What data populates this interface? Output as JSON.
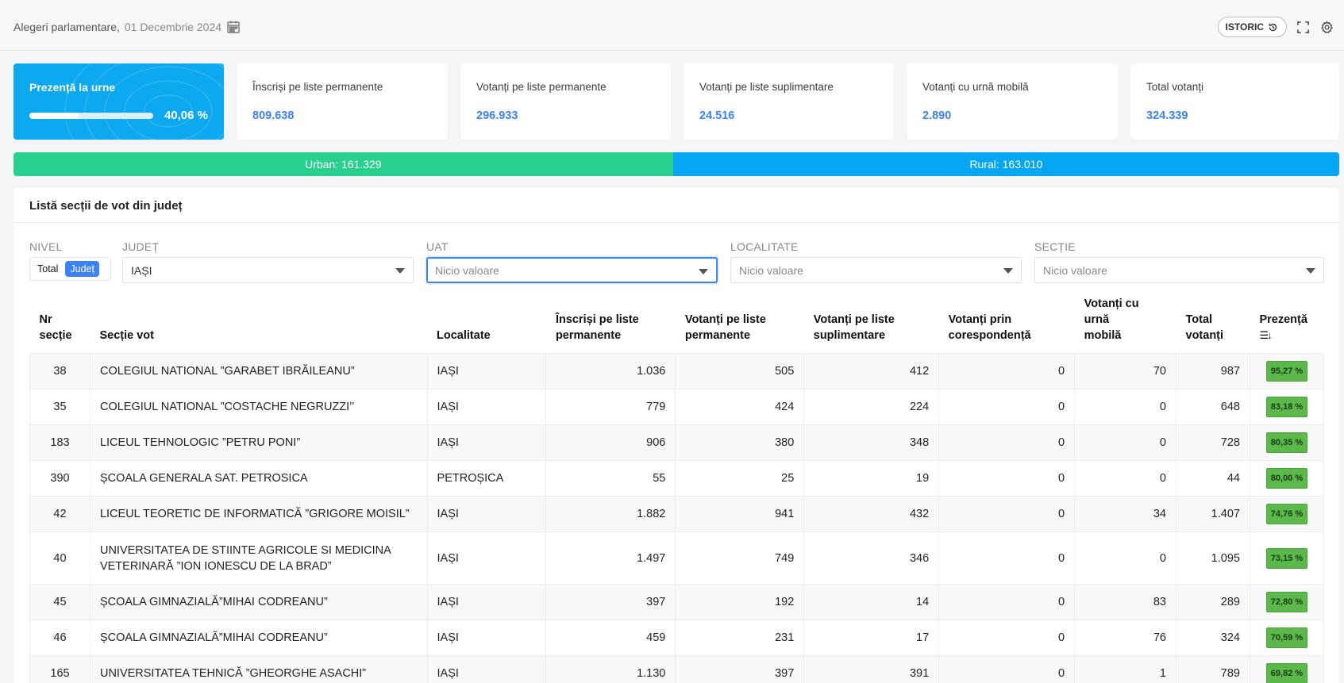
{
  "header": {
    "title": "Alegeri parlamentare,",
    "date": "01 Decembrie 2024",
    "istoric_label": "ISTORIC"
  },
  "cards": [
    {
      "label": "Prezență la urne",
      "value": "40,06 %",
      "progress": 0.4006
    },
    {
      "label": "Înscriși pe liste permanente",
      "value": "809.638"
    },
    {
      "label": "Votanți pe liste permanente",
      "value": "296.933"
    },
    {
      "label": "Votanți pe liste suplimentare",
      "value": "24.516"
    },
    {
      "label": "Votanți cu urnă mobilă",
      "value": "2.890"
    },
    {
      "label": "Total votanți",
      "value": "324.339"
    }
  ],
  "split": {
    "urban_label": "Urban: 161.329",
    "rural_label": "Rural: 163.010",
    "urban_value": 161329,
    "rural_value": 163010
  },
  "panel": {
    "title": "Listă secții de vot din județ"
  },
  "filters": {
    "nivel_label": "NIVEL",
    "nivel_options": [
      "Total",
      "Județ"
    ],
    "judet_label": "JUDEȚ",
    "judet_value": "IAȘI",
    "uat_label": "UAT",
    "uat_placeholder": "Nicio valoare",
    "localitate_label": "LOCALITATE",
    "localitate_placeholder": "Nicio valoare",
    "sectie_label": "SECȚIE",
    "sectie_placeholder": "Nicio valoare"
  },
  "table": {
    "headers": {
      "nr_line1": "Nr",
      "nr_line2": "secție",
      "sectie": "Secție vot",
      "localitate": "Localitate",
      "inscrisi_line1": "Înscriși pe liste",
      "inscrisi_line2": "permanente",
      "vot_perm_line1": "Votanți pe liste",
      "vot_perm_line2": "permanente",
      "vot_supl_line1": "Votanți pe liste",
      "vot_supl_line2": "suplimentare",
      "vot_cores_line1": "Votanți prin",
      "vot_cores_line2": "corespondență",
      "vot_mobil_line1": "Votanți cu urnă",
      "vot_mobil_line2": "mobilă",
      "total_line1": "Total",
      "total_line2": "votanți",
      "prezenta": "Prezență",
      "sort_icon": "☰↓"
    },
    "rows": [
      {
        "nr": "38",
        "sectie": "COLEGIUL NATIONAL ”GARABET IBRĂILEANU”",
        "localitate": "IAȘI",
        "inscrisi": "1.036",
        "perm": "505",
        "supl": "412",
        "cores": "0",
        "mobil": "70",
        "total": "987",
        "prezenta": "95,27 %"
      },
      {
        "nr": "35",
        "sectie": "COLEGIUL NATIONAL ”COSTACHE NEGRUZZI’’",
        "localitate": "IAȘI",
        "inscrisi": "779",
        "perm": "424",
        "supl": "224",
        "cores": "0",
        "mobil": "0",
        "total": "648",
        "prezenta": "83,18 %"
      },
      {
        "nr": "183",
        "sectie": "LICEUL TEHNOLOGIC ”PETRU PONI”",
        "localitate": "IAȘI",
        "inscrisi": "906",
        "perm": "380",
        "supl": "348",
        "cores": "0",
        "mobil": "0",
        "total": "728",
        "prezenta": "80,35 %"
      },
      {
        "nr": "390",
        "sectie": "ȘCOALA GENERALA SAT. PETROSICA",
        "localitate": "PETROȘICA",
        "inscrisi": "55",
        "perm": "25",
        "supl": "19",
        "cores": "0",
        "mobil": "0",
        "total": "44",
        "prezenta": "80,00 %"
      },
      {
        "nr": "42",
        "sectie": "LICEUL TEORETIC DE INFORMATICĂ ”GRIGORE MOISIL”",
        "localitate": "IAȘI",
        "inscrisi": "1.882",
        "perm": "941",
        "supl": "432",
        "cores": "0",
        "mobil": "34",
        "total": "1.407",
        "prezenta": "74,76 %"
      },
      {
        "nr": "40",
        "sectie_line1": "UNIVERSITATEA DE STIINTE AGRICOLE SI MEDICINA",
        "sectie_line2": "VETERINARĂ ”ION IONESCU DE LA BRAD”",
        "localitate": "IAȘI",
        "inscrisi": "1.497",
        "perm": "749",
        "supl": "346",
        "cores": "0",
        "mobil": "0",
        "total": "1.095",
        "prezenta": "73,15 %"
      },
      {
        "nr": "45",
        "sectie": "ȘCOALA GIMNAZIALĂ”MIHAI CODREANU”",
        "localitate": "IAȘI",
        "inscrisi": "397",
        "perm": "192",
        "supl": "14",
        "cores": "0",
        "mobil": "83",
        "total": "289",
        "prezenta": "72,80 %"
      },
      {
        "nr": "46",
        "sectie": "ȘCOALA GIMNAZIALĂ”MIHAI CODREANU”",
        "localitate": "IAȘI",
        "inscrisi": "459",
        "perm": "231",
        "supl": "17",
        "cores": "0",
        "mobil": "76",
        "total": "324",
        "prezenta": "70,59 %"
      },
      {
        "nr": "165",
        "sectie": "UNIVERSITATEA TEHNICĂ ”GHEORGHE ASACHI”",
        "localitate": "IAȘI",
        "inscrisi": "1.130",
        "perm": "397",
        "supl": "391",
        "cores": "0",
        "mobil": "1",
        "total": "789",
        "prezenta": "69,82 %"
      }
    ]
  },
  "colors": {
    "accent": "#3b82f6",
    "prezenta_card": "#0ca8f0",
    "urban": "#27d08f",
    "rural": "#06a6f3",
    "badge": "#5cb84a"
  }
}
